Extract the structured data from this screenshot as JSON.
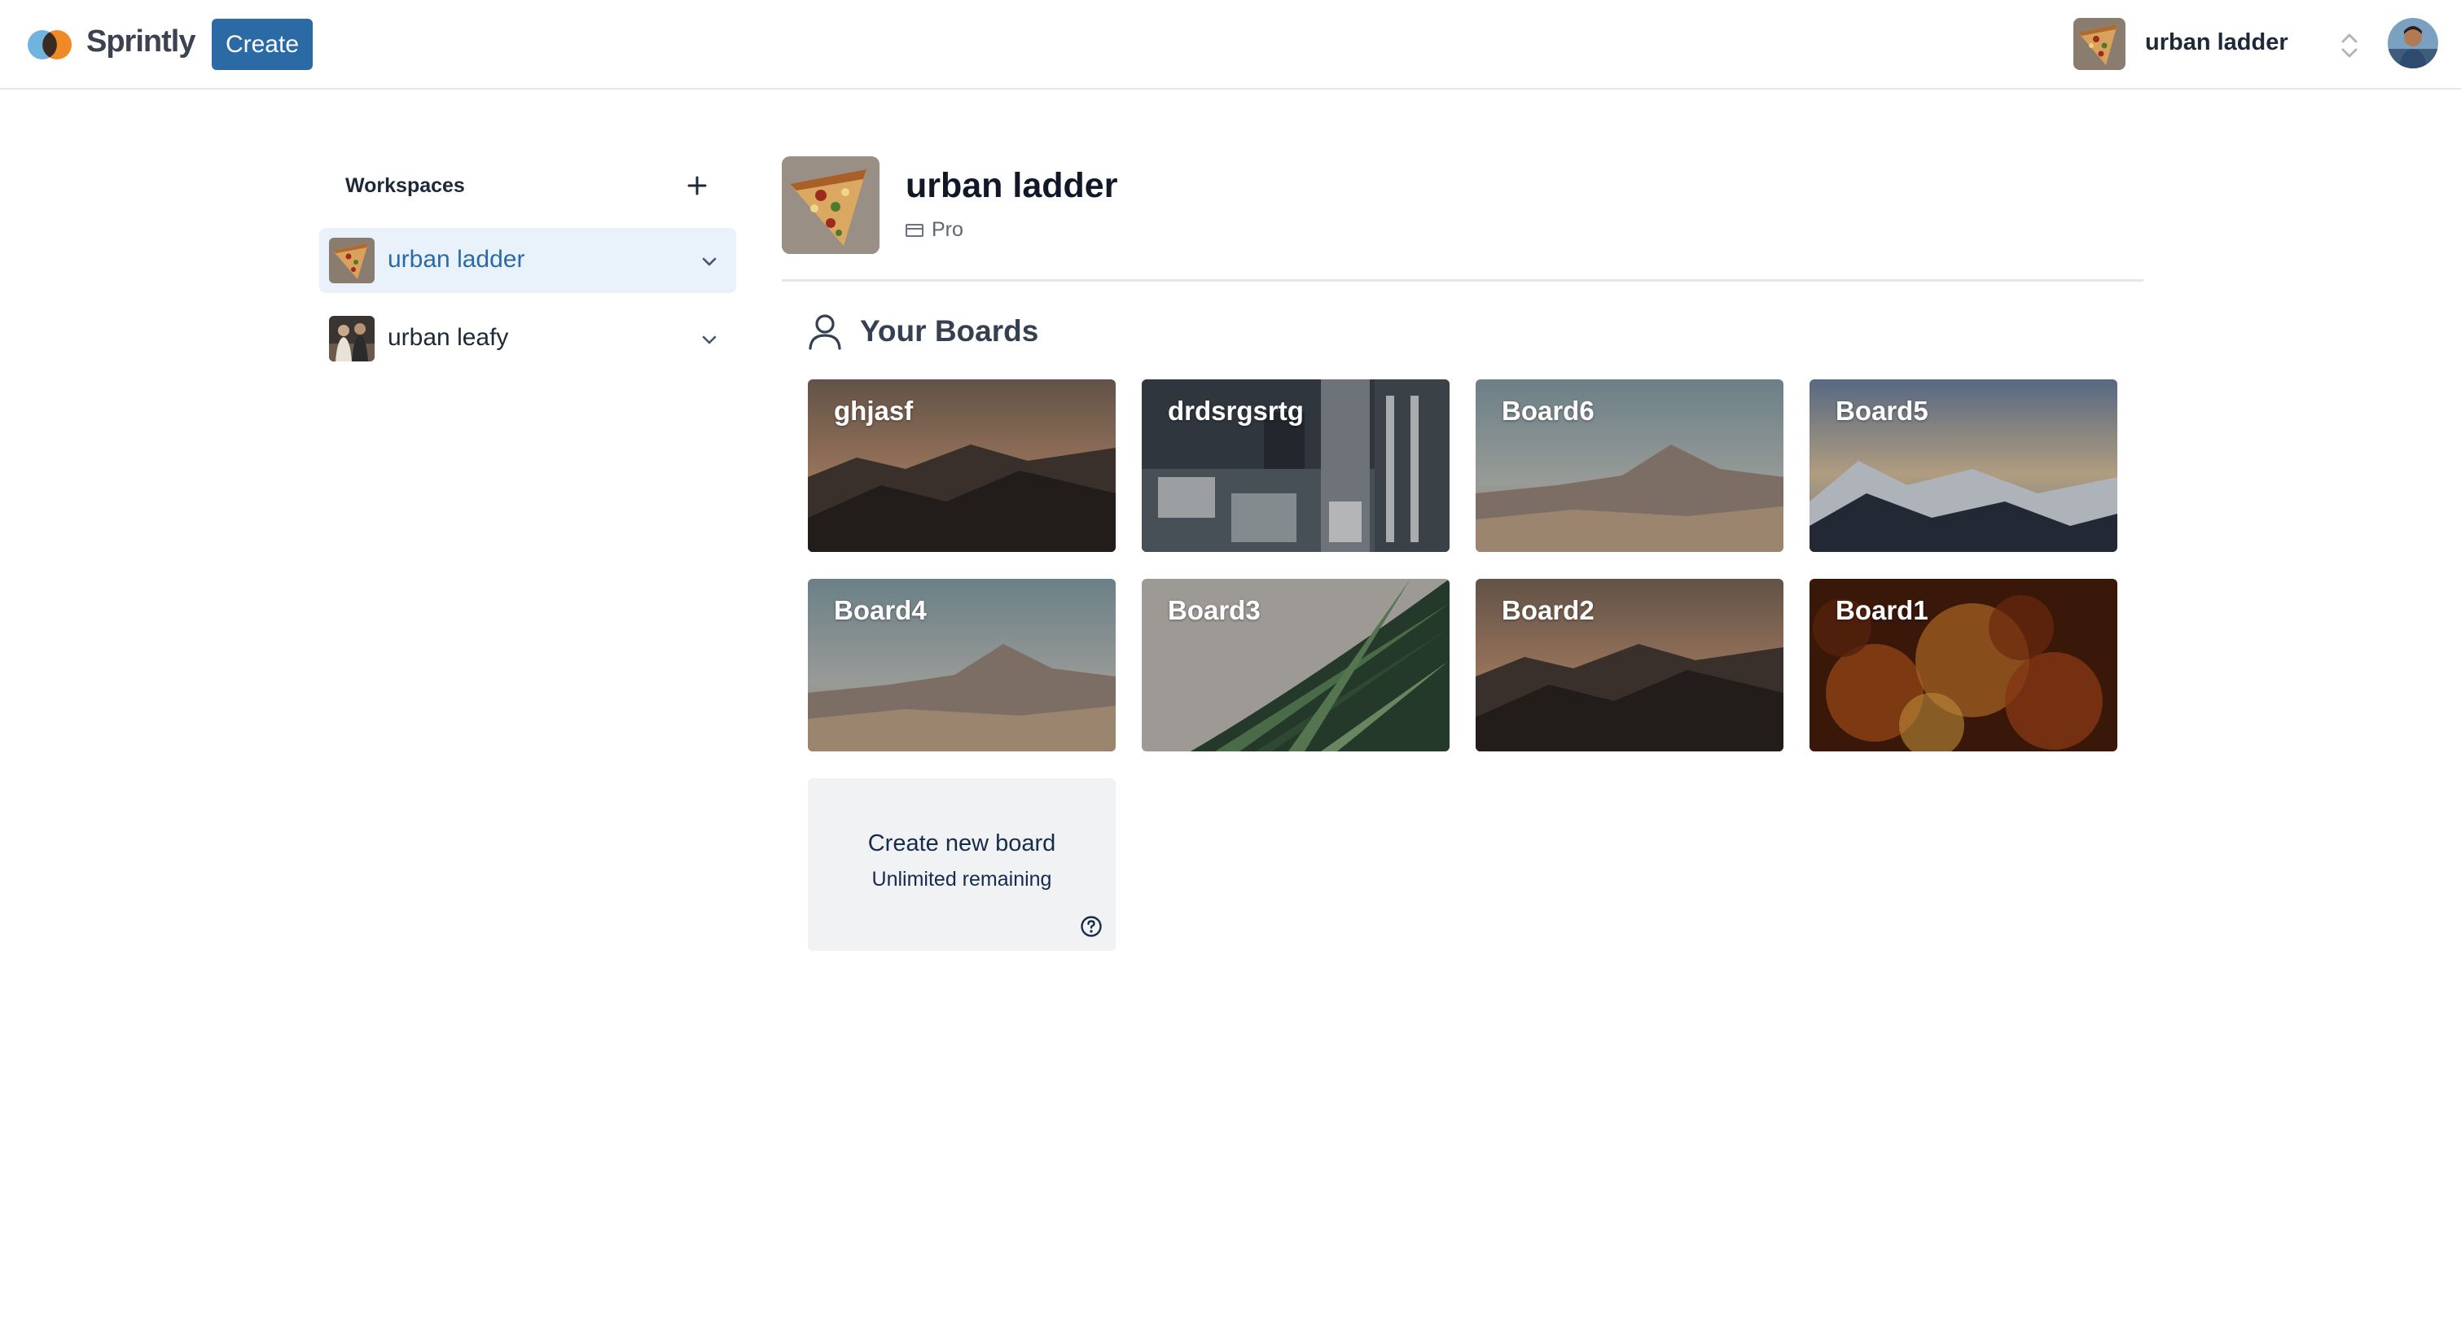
{
  "app": {
    "brand": "Sprintly",
    "create_label": "Create"
  },
  "topbar": {
    "workspace_name": "urban ladder"
  },
  "sidebar": {
    "heading": "Workspaces",
    "workspaces": [
      {
        "name": "urban ladder",
        "active": true
      },
      {
        "name": "urban leafy",
        "active": false
      }
    ]
  },
  "workspace": {
    "name": "urban ladder",
    "plan": "Pro"
  },
  "boards_section": {
    "title": "Your Boards",
    "boards": [
      {
        "title": "ghjasf",
        "theme": "dusk-mountains"
      },
      {
        "title": "drdsrgsrtg",
        "theme": "city-aerial"
      },
      {
        "title": "Board6",
        "theme": "desert-mountains"
      },
      {
        "title": "Board5",
        "theme": "snowy-mountains"
      },
      {
        "title": "Board4",
        "theme": "desert-mountains"
      },
      {
        "title": "Board3",
        "theme": "palm-leaf"
      },
      {
        "title": "Board2",
        "theme": "dusk-mountains"
      },
      {
        "title": "Board1",
        "theme": "autumn-leaves"
      }
    ],
    "create": {
      "title": "Create new board",
      "subtitle": "Unlimited remaining"
    }
  },
  "colors": {
    "primary": "#2c6aa5",
    "active_bg": "#e9f2fb",
    "create_card_bg": "#f1f2f4"
  }
}
